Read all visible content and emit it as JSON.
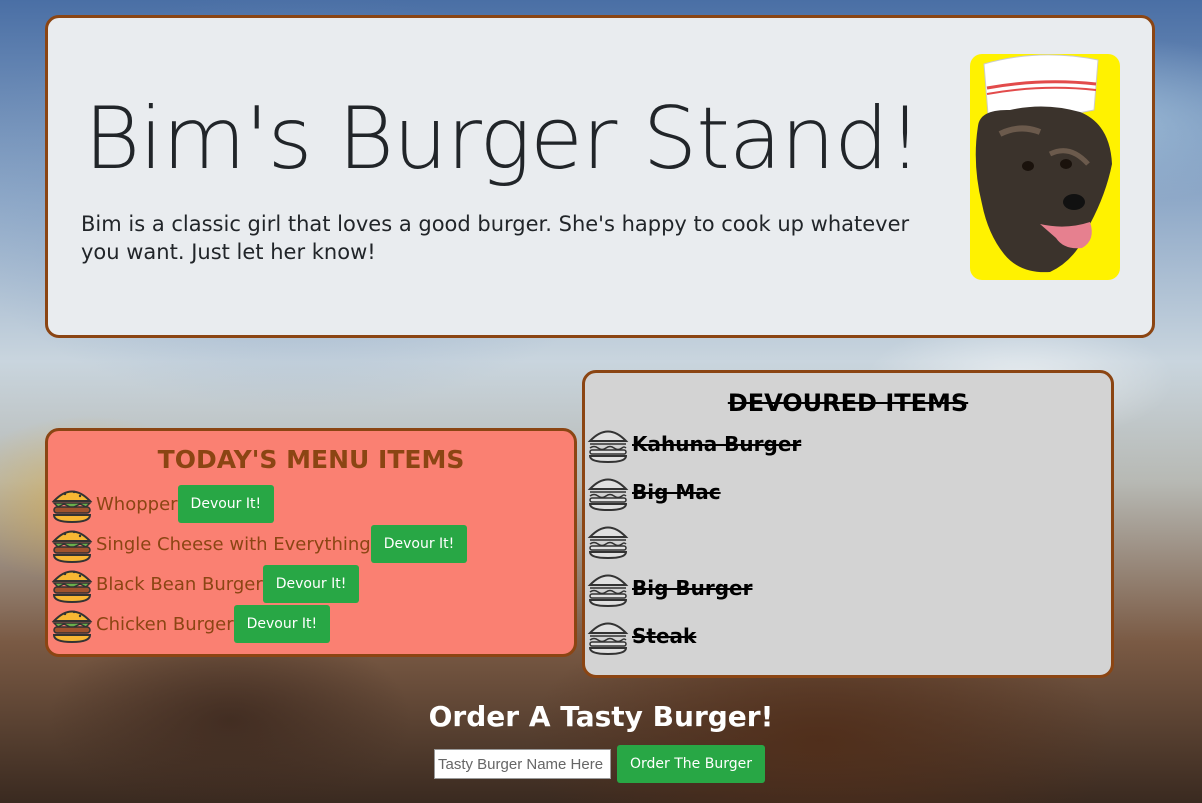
{
  "header": {
    "title": "Bim's Burger Stand!",
    "description": "Bim is a classic girl that loves a good burger. She's happy to cook up whatever you want. Just let her know!"
  },
  "menu": {
    "title": "TODAY'S MENU ITEMS",
    "button_label": "Devour It!",
    "items": [
      {
        "name": "Whopper"
      },
      {
        "name": "Single Cheese with Everything"
      },
      {
        "name": "Black Bean Burger"
      },
      {
        "name": "Chicken Burger"
      }
    ]
  },
  "devoured": {
    "title": "DEVOURED ITEMS",
    "items": [
      {
        "name": "Kahuna Burger"
      },
      {
        "name": "Big Mac"
      },
      {
        "name": ""
      },
      {
        "name": "Big Burger"
      },
      {
        "name": "Steak"
      }
    ]
  },
  "order": {
    "title": "Order A Tasty Burger!",
    "placeholder": "Tasty Burger Name Here",
    "button_label": "Order The Burger"
  },
  "colors": {
    "accent_border": "#8b4513",
    "menu_bg": "#fa8072",
    "devoured_bg": "#d3d3d3",
    "button_green": "#28a745"
  },
  "icons": {
    "menu_item": "burger-icon",
    "devoured_item": "burger-outline-icon"
  }
}
